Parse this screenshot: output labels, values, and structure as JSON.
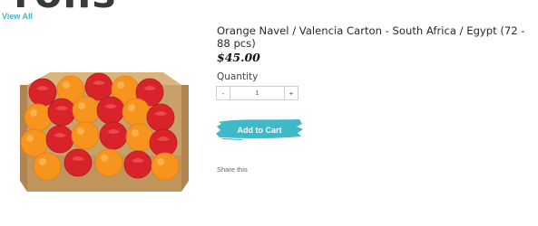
{
  "page": {
    "heading_partial": "-rolls",
    "view_all_label": "View All"
  },
  "product": {
    "title": "Orange Navel / Valencia Carton - South Africa / Egypt (72 - 88 pcs)",
    "price": "$45.00",
    "image_alt": "Carton of oranges wrapped in red paper",
    "quantity_label": "Quantity",
    "quantity_value": "1",
    "minus_label": "-",
    "plus_label": "+",
    "add_to_cart_label": "Add to Cart",
    "share_label": "Share this"
  },
  "colors": {
    "accent": "#3fb8c7",
    "heading": "#3a3a3a",
    "orange": "#f7941d",
    "wrapper": "#d8232a",
    "carton": "#c8a06a"
  }
}
